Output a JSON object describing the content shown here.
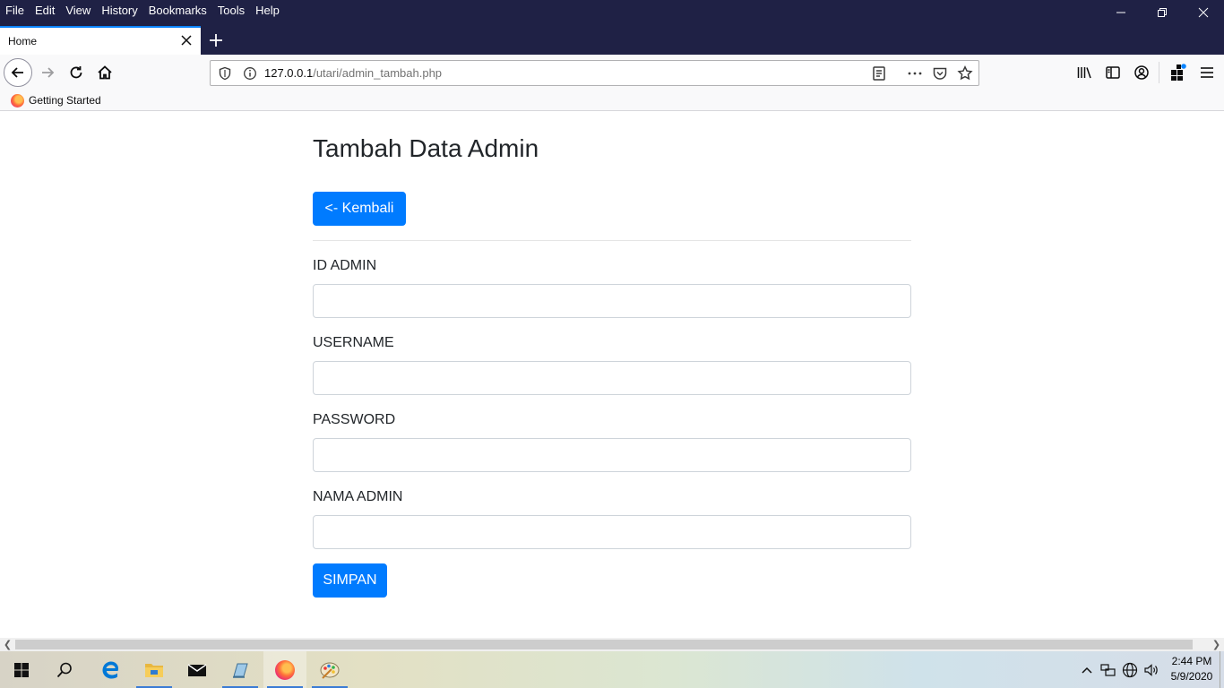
{
  "menu": [
    "File",
    "Edit",
    "View",
    "History",
    "Bookmarks",
    "Tools",
    "Help"
  ],
  "tab": {
    "title": "Home"
  },
  "url": {
    "host": "127.0.0.1",
    "path": "/utari/admin_tambah.php"
  },
  "bookmarks": {
    "getting_started": "Getting Started"
  },
  "page": {
    "title": "Tambah Data Admin",
    "back_button": "<- Kembali",
    "fields": [
      {
        "label": "ID ADMIN",
        "value": ""
      },
      {
        "label": "USERNAME",
        "value": ""
      },
      {
        "label": "PASSWORD",
        "value": ""
      },
      {
        "label": "NAMA ADMIN",
        "value": ""
      }
    ],
    "save_button": "SIMPAN"
  },
  "taskbar": {
    "time": "2:44 PM",
    "date": "5/9/2020"
  },
  "colors": {
    "titlebar": "#1f2145",
    "primary": "#007bff",
    "tab_accent": "#0a84ff"
  }
}
